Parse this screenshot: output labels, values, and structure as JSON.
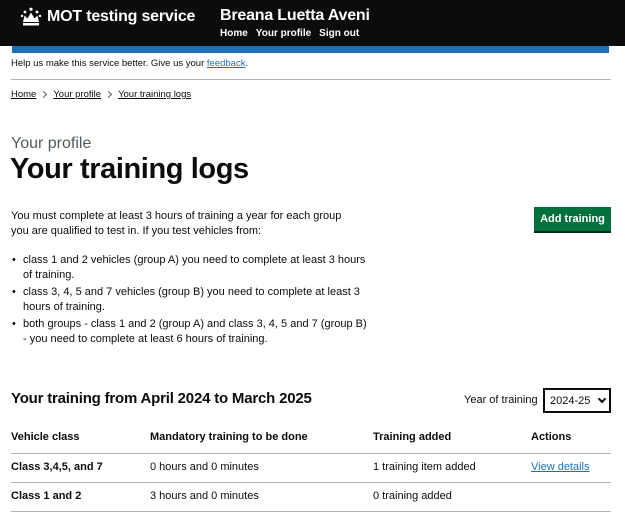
{
  "header": {
    "service_name": "MOT testing service",
    "user_name": "Breana Luetta Aveni",
    "nav": [
      "Home",
      "Your profile",
      "Sign out"
    ]
  },
  "phase_banner": {
    "text": "Help us make this service better. Give us your ",
    "link": "feedback",
    "suffix": "."
  },
  "breadcrumbs": [
    "Home",
    "Your profile",
    "Your training logs"
  ],
  "page": {
    "caption": "Your profile",
    "title": "Your training logs",
    "intro": "You must complete at least 3 hours of training a year for each group you are qualified to test in. If you test vehicles from:",
    "bullets": [
      "class 1 and 2 vehicles (group A) you need to complete at least 3 hours of training.",
      "class 3, 4, 5 and 7 vehicles (group B) you need to complete at least 3 hours of training.",
      "both groups - class 1 and 2 (group A) and class 3, 4, 5 and 7 (group B) - you need to complete at least 6 hours of training."
    ],
    "add_button": "Add training"
  },
  "training": {
    "heading": "Your training from April 2024 to March 2025",
    "year_label": "Year of training",
    "year_selected": "2024-25",
    "columns": [
      "Vehicle class",
      "Mandatory training to be done",
      "Training added",
      "Actions"
    ],
    "rows": [
      {
        "vehicle_class": "Class 3,4,5, and 7",
        "mandatory": "0 hours and 0 minutes",
        "added": "1 training item added",
        "action": "View details"
      },
      {
        "vehicle_class": "Class 1 and 2",
        "mandatory": "3 hours and 0 minutes",
        "added": "0 training added",
        "action": ""
      }
    ]
  },
  "colors": {
    "header_bg": "#0b0c0c",
    "accent_blue": "#1d70b8",
    "button_green": "#00703c",
    "link": "#1d70b8"
  },
  "icons": [
    "crown-icon",
    "breadcrumb-chevron-icon",
    "chevron-down-icon"
  ]
}
